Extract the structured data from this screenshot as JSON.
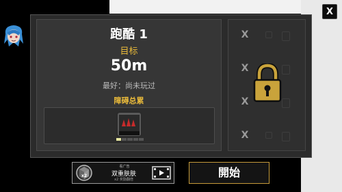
{
  "level": {
    "title": "跑酷 1",
    "goal_label": "目标",
    "goal_value": "50m",
    "best_record": "最好：尚未玩过",
    "obstacle_label": "障碍总累",
    "progress_fraction": 0.2
  },
  "buttons": {
    "close": "X",
    "start": "開始",
    "ad_top": "看广告",
    "ad_main": "双重肤肤",
    "ad_sub": "x2 奖励翻倍",
    "ad_coin_badge": "x2"
  },
  "locked_slots": {
    "marks": [
      "X",
      "X",
      "X",
      "X"
    ]
  },
  "colors": {
    "accent_gold": "#e8b93a",
    "lock_gold": "#c9a33b"
  },
  "icons": [
    "close-icon",
    "avatar-icon",
    "spike-obstacle-icon",
    "padlock-icon",
    "coin-x2-icon",
    "video-ad-icon"
  ]
}
